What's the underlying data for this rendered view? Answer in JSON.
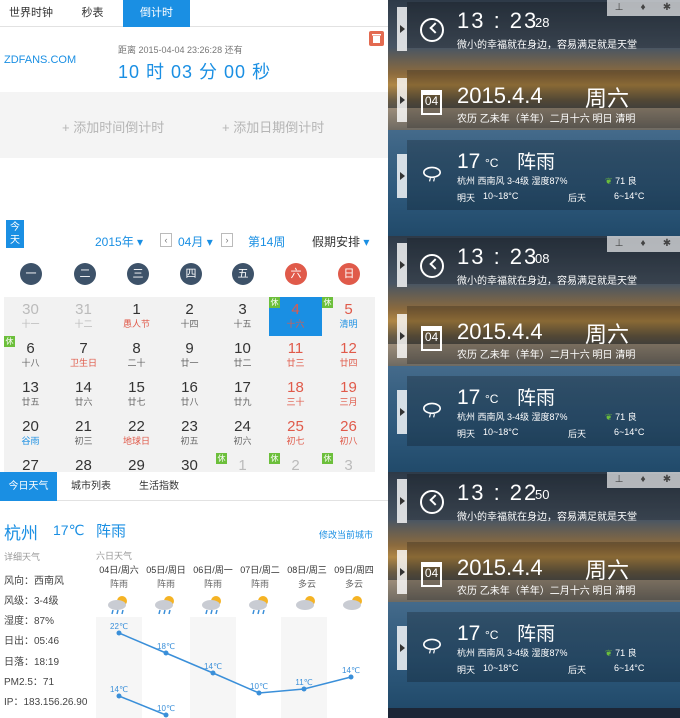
{
  "left": {
    "tabs": [
      "世界时钟",
      "秒表",
      "倒计时"
    ],
    "countdown": {
      "site": "ZDFANS.COM",
      "desc": "距离 2015-04-04 23:26:28 还有",
      "remaining": "10 时 03 分 00 秒"
    },
    "add_buttons": [
      "+ 添加时间倒计时",
      "+ 添加日期倒计时"
    ],
    "calendar": {
      "today_badge": "今天",
      "year": "2015年",
      "month": "04月",
      "week": "第14周",
      "holiday_menu": "假期安排",
      "weekdays": [
        "一",
        "二",
        "三",
        "四",
        "五",
        "六",
        "日"
      ],
      "rows": [
        [
          [
            "30",
            "十一"
          ],
          [
            "31",
            "十二"
          ],
          [
            "1",
            "愚人节"
          ],
          [
            "2",
            "十四"
          ],
          [
            "3",
            "十五"
          ],
          [
            "4",
            "十六"
          ],
          [
            "5",
            "清明"
          ]
        ],
        [
          [
            "6",
            "十八"
          ],
          [
            "7",
            "卫生日"
          ],
          [
            "8",
            "二十"
          ],
          [
            "9",
            "廿一"
          ],
          [
            "10",
            "廿二"
          ],
          [
            "11",
            "廿三"
          ],
          [
            "12",
            "廿四"
          ]
        ],
        [
          [
            "13",
            "廿五"
          ],
          [
            "14",
            "廿六"
          ],
          [
            "15",
            "廿七"
          ],
          [
            "16",
            "廿八"
          ],
          [
            "17",
            "廿九"
          ],
          [
            "18",
            "三十"
          ],
          [
            "19",
            "三月"
          ]
        ],
        [
          [
            "20",
            "谷雨"
          ],
          [
            "21",
            "初三"
          ],
          [
            "22",
            "地球日"
          ],
          [
            "23",
            "初五"
          ],
          [
            "24",
            "初六"
          ],
          [
            "25",
            "初七"
          ],
          [
            "26",
            "初八"
          ]
        ],
        [
          [
            "27",
            ""
          ],
          [
            "28",
            ""
          ],
          [
            "29",
            ""
          ],
          [
            "30",
            ""
          ],
          [
            "1",
            ""
          ],
          [
            "2",
            ""
          ],
          [
            "3",
            ""
          ]
        ]
      ],
      "rest_badge": "休"
    },
    "weather_tabs": [
      "今日天气",
      "城市列表",
      "生活指数"
    ],
    "weather": {
      "city": "杭州",
      "temp": "17℃",
      "cond": "阵雨",
      "modify": "修改当前城市",
      "detail_title": "详细天气",
      "details": [
        "风向：西南风",
        "风级：3-4级",
        "湿度：87%",
        "日出：05:46",
        "日落：18:19",
        "PM2.5：71",
        "IP：183.156.26.90"
      ],
      "six_title": "六日天气",
      "forecast": [
        {
          "date": "04日/周六",
          "cond": "阵雨"
        },
        {
          "date": "05日/周日",
          "cond": "阵雨"
        },
        {
          "date": "06日/周一",
          "cond": "阵雨"
        },
        {
          "date": "07日/周二",
          "cond": "阵雨"
        },
        {
          "date": "08日/周三",
          "cond": "多云"
        },
        {
          "date": "09日/周四",
          "cond": "多云"
        }
      ],
      "highs": [
        "22℃",
        "18℃",
        "14℃",
        "10℃",
        "11℃",
        "14℃"
      ],
      "lows": [
        "14℃",
        "10℃"
      ]
    }
  },
  "right": {
    "motto": "微小的幸福就在身边，容易满足就是天堂",
    "panels": [
      {
        "time": "13 : 23",
        "sec": "28"
      },
      {
        "time": "13 : 23",
        "sec": "08"
      },
      {
        "time": "13 : 22",
        "sec": "50"
      }
    ],
    "cal_day": "04",
    "date": "2015.4.4",
    "weekday": "周六",
    "lunar": "农历 乙未年（羊年）二月十六  明日 清明",
    "temp": "17",
    "deg": "°C",
    "cond": "阵雨",
    "line1": "杭州  西南风 3-4级  湿度87%",
    "aqi": "71 良",
    "tomorrow": "明天",
    "tomorrow_range": "10~18°C",
    "after": "后天",
    "after_range": "6~14°C"
  }
}
